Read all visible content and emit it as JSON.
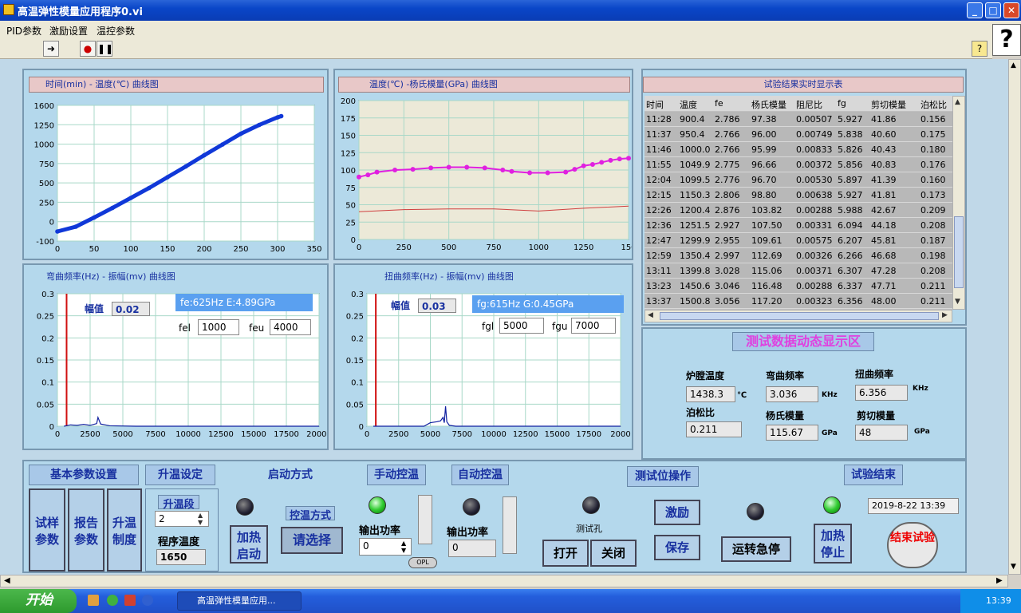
{
  "window": {
    "title": "高温弹性模量应用程序0.vi"
  },
  "menu": [
    "PID参数",
    "激励设置",
    "温控参数"
  ],
  "charts": {
    "time_temp": {
      "title": "时间(min) - 温度(℃) 曲线图",
      "xticks": [
        "0",
        "50",
        "100",
        "150",
        "200",
        "250",
        "300",
        "350"
      ],
      "yticks": [
        "1600",
        "1250",
        "1000",
        "750",
        "500",
        "250",
        "0",
        "-100"
      ]
    },
    "temp_modulus": {
      "title": "温度(℃) -杨氏模量(GPa) 曲线图",
      "xticks": [
        "0",
        "250",
        "500",
        "750",
        "1000",
        "1250",
        "150"
      ],
      "yticks": [
        "200",
        "175",
        "150",
        "125",
        "100",
        "75",
        "50",
        "25",
        "0"
      ]
    },
    "bend_freq": {
      "title": "弯曲频率(Hz) - 振幅(mv) 曲线图",
      "xticks": [
        "0",
        "2500",
        "5000",
        "7500",
        "10000",
        "12500",
        "15000",
        "17500",
        "20000"
      ],
      "yticks": [
        "0.3",
        "0.25",
        "0.2",
        "0.15",
        "0.1",
        "0.05",
        "0"
      ],
      "amp_label": "幅值",
      "amp_value": "0.02",
      "result": "fe:625Hz E:4.89GPa",
      "fel_label": "fel",
      "fel_value": "1000",
      "feu_label": "feu",
      "feu_value": "4000"
    },
    "tors_freq": {
      "title": "扭曲频率(Hz) - 振幅(mv) 曲线图",
      "xticks": [
        "0",
        "2500",
        "5000",
        "7500",
        "10000",
        "12500",
        "15000",
        "17500",
        "2000"
      ],
      "yticks": [
        "0.3",
        "0.25",
        "0.2",
        "0.15",
        "0.1",
        "0.05",
        "0"
      ],
      "amp_label": "幅值",
      "amp_value": "0.03",
      "result": "fg:615Hz G:0.45GPa",
      "fgl_label": "fgl",
      "fgl_value": "5000",
      "fgu_label": "fgu",
      "fgu_value": "7000"
    }
  },
  "chart_data": [
    {
      "type": "scatter",
      "title": "时间(min) - 温度(℃) 曲线图",
      "xlim": [
        0,
        350
      ],
      "ylim": [
        -100,
        1600
      ],
      "series": [
        {
          "values": [
            [
              0,
              20
            ],
            [
              25,
              80
            ],
            [
              50,
              195
            ],
            [
              75,
              315
            ],
            [
              100,
              440
            ],
            [
              125,
              565
            ],
            [
              150,
              700
            ],
            [
              175,
              835
            ],
            [
              200,
              975
            ],
            [
              225,
              1110
            ],
            [
              250,
              1245
            ],
            [
              275,
              1355
            ],
            [
              300,
              1450
            ],
            [
              305,
              1465
            ]
          ]
        }
      ]
    },
    {
      "type": "line",
      "title": "温度(℃) -杨氏模量(GPa) 曲线图",
      "xlim": [
        0,
        1500
      ],
      "ylim": [
        0,
        200
      ],
      "series": [
        {
          "values": [
            [
              0,
              90
            ],
            [
              50,
              93
            ],
            [
              100,
              97
            ],
            [
              200,
              100
            ],
            [
              300,
              101
            ],
            [
              400,
              103
            ],
            [
              500,
              104
            ],
            [
              600,
              104
            ],
            [
              700,
              103
            ],
            [
              800,
              100
            ],
            [
              850,
              98
            ],
            [
              950,
              96
            ],
            [
              1050,
              96
            ],
            [
              1150,
              97
            ],
            [
              1200,
              101
            ],
            [
              1250,
              106
            ],
            [
              1300,
              108
            ],
            [
              1350,
              111
            ],
            [
              1400,
              114
            ],
            [
              1450,
              116
            ],
            [
              1500,
              117
            ]
          ]
        },
        {
          "values": [
            [
              0,
              40
            ],
            [
              250,
              43
            ],
            [
              500,
              44
            ],
            [
              750,
              44
            ],
            [
              1000,
              41
            ],
            [
              1250,
              45
            ],
            [
              1500,
              48
            ]
          ]
        }
      ]
    },
    {
      "type": "line",
      "title": "弯曲频率(Hz) - 振幅(mv) 曲线图",
      "xlim": [
        0,
        20000
      ],
      "ylim": [
        0,
        0.3
      ],
      "series": [
        {
          "values": [
            [
              500,
              0
            ],
            [
              1000,
              0.003
            ],
            [
              1500,
              0.002
            ],
            [
              2000,
              0.004
            ],
            [
              2500,
              0.002
            ],
            [
              3000,
              0.006
            ],
            [
              3100,
              0.02
            ],
            [
              3300,
              0.005
            ],
            [
              4000,
              0.001
            ],
            [
              6000,
              0
            ],
            [
              20000,
              0
            ]
          ]
        }
      ]
    },
    {
      "type": "line",
      "title": "扭曲频率(Hz) - 振幅(mv) 曲线图",
      "xlim": [
        0,
        20000
      ],
      "ylim": [
        0,
        0.3
      ],
      "series": [
        {
          "values": [
            [
              500,
              0
            ],
            [
              4500,
              0
            ],
            [
              5000,
              0.008
            ],
            [
              5500,
              0.01
            ],
            [
              5800,
              0.012
            ],
            [
              6000,
              0.02
            ],
            [
              6100,
              0.008
            ],
            [
              6200,
              0.045
            ],
            [
              6300,
              0.01
            ],
            [
              6500,
              0.002
            ],
            [
              7000,
              0
            ],
            [
              20000,
              0
            ]
          ]
        }
      ]
    }
  ],
  "results_table": {
    "title": "试验结果实时显示表",
    "headers": [
      "时间",
      "温度",
      "fe",
      "杨氏模量",
      "阻尼比",
      "fg",
      "剪切模量",
      "泊松比"
    ],
    "rows": [
      [
        "11:28",
        "900.4",
        "2.786",
        "97.38",
        "0.00507",
        "5.927",
        "41.86",
        "0.156"
      ],
      [
        "11:37",
        "950.4",
        "2.766",
        "96.00",
        "0.00749",
        "5.838",
        "40.60",
        "0.175"
      ],
      [
        "11:46",
        "1000.0",
        "2.766",
        "95.99",
        "0.00833",
        "5.826",
        "40.43",
        "0.180"
      ],
      [
        "11:55",
        "1049.9",
        "2.775",
        "96.66",
        "0.00372",
        "5.856",
        "40.83",
        "0.176"
      ],
      [
        "12:04",
        "1099.5",
        "2.776",
        "96.70",
        "0.00530",
        "5.897",
        "41.39",
        "0.160"
      ],
      [
        "12:15",
        "1150.3",
        "2.806",
        "98.80",
        "0.00638",
        "5.927",
        "41.81",
        "0.173"
      ],
      [
        "12:26",
        "1200.4",
        "2.876",
        "103.82",
        "0.00288",
        "5.988",
        "42.67",
        "0.209"
      ],
      [
        "12:36",
        "1251.5",
        "2.927",
        "107.50",
        "0.00331",
        "6.094",
        "44.18",
        "0.208"
      ],
      [
        "12:47",
        "1299.9",
        "2.955",
        "109.61",
        "0.00575",
        "6.207",
        "45.81",
        "0.187"
      ],
      [
        "12:59",
        "1350.4",
        "2.997",
        "112.69",
        "0.00326",
        "6.266",
        "46.68",
        "0.198"
      ],
      [
        "13:11",
        "1399.8",
        "3.028",
        "115.06",
        "0.00371",
        "6.307",
        "47.28",
        "0.208"
      ],
      [
        "13:23",
        "1450.6",
        "3.046",
        "116.48",
        "0.00288",
        "6.337",
        "47.71",
        "0.211"
      ],
      [
        "13:37",
        "1500.8",
        "3.056",
        "117.20",
        "0.00323",
        "6.356",
        "48.00",
        "0.211"
      ]
    ]
  },
  "dynamic": {
    "title": "测试数据动态显示区",
    "furnace_label": "炉膛温度",
    "furnace_value": "1438.3",
    "furnace_unit": "℃",
    "bend_label": "弯曲频率",
    "bend_value": "3.036",
    "bend_unit": "KHz",
    "tors_label": "扭曲频率",
    "tors_value": "6.356",
    "tors_unit": "KHz",
    "poisson_label": "泊松比",
    "poisson_value": "0.211",
    "young_label": "杨氏模量",
    "young_value": "115.67",
    "young_unit": "GPa",
    "shear_label": "剪切模量",
    "shear_value": "48",
    "shear_unit": "GPa"
  },
  "bottom": {
    "basic": "基本参数设置",
    "sample": "试样参数",
    "report": "报告参数",
    "heat_sys": "升温制度",
    "ramp": "升温设定",
    "ramp_seg_label": "升温段",
    "ramp_seg_value": "2",
    "prog_temp_label": "程序温度",
    "prog_temp_value": "1650",
    "start_mode": "启动方式",
    "heat_start": "加热启动",
    "ctrl_mode_label": "控温方式",
    "ctrl_select": "请选择",
    "manual": "手动控温",
    "out_power_label": "输出功率",
    "manual_power": "0",
    "opl": "OPL",
    "auto": "自动控温",
    "auto_power": "0",
    "test_ops": "测试位操作",
    "test_hole": "测试孔",
    "excite": "激励",
    "save": "保存",
    "open": "打开",
    "close": "关闭",
    "estop": "运转急停",
    "test_end": "试验结束",
    "heat_stop": "加热停止",
    "datetime": "2019-8-22 13:39",
    "end_test": "结束试验"
  },
  "taskbar": {
    "start": "开始",
    "task": "高温弹性模量应用...",
    "clock": "13:39"
  }
}
